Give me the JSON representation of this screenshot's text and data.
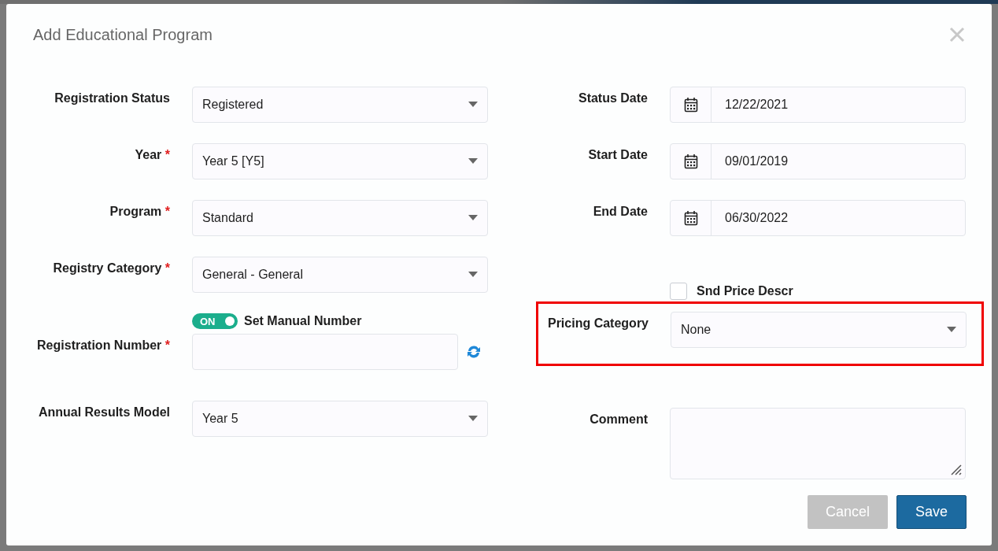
{
  "dialog": {
    "title": "Add Educational Program"
  },
  "left_fields": [
    {
      "kind": "select",
      "label": "Registration Status",
      "value": "Registered"
    },
    {
      "kind": "select",
      "label": "Year",
      "required_mark": "*",
      "value": "Year 5 [Y5]"
    },
    {
      "kind": "select",
      "label": "Program",
      "required_mark": "*",
      "value": "Standard"
    },
    {
      "kind": "select",
      "label": "Registry Category",
      "required_mark": "*",
      "value": "General - General"
    },
    {
      "kind": "number",
      "label": "Registration Number",
      "required_mark": "*",
      "toggle": {
        "on": true,
        "state_text": "ON",
        "label": "Set Manual Number"
      }
    },
    {
      "kind": "select",
      "label": "Annual Results Model",
      "value": "Year 5"
    }
  ],
  "right_fields": [
    {
      "kind": "date",
      "label": "Status Date",
      "value": "12/22/2021"
    },
    {
      "kind": "date",
      "label": "Start Date",
      "value": "09/01/2019"
    },
    {
      "kind": "date",
      "label": "End Date",
      "value": "06/30/2022"
    },
    {
      "kind": "checkbox",
      "label": "Snd Price Descr",
      "checked": false
    },
    {
      "kind": "select",
      "label": "Pricing Category",
      "value": "None",
      "highlighted": true
    },
    {
      "kind": "textarea",
      "label": "Comment"
    }
  ],
  "buttons": [
    {
      "label": "Cancel",
      "disabled": true
    },
    {
      "label": "Save",
      "disabled": false
    }
  ]
}
